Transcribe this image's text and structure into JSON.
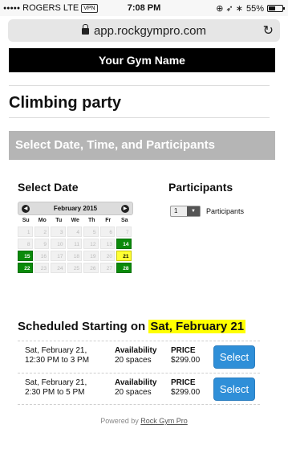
{
  "status": {
    "signal_dots": "●●●●●",
    "carrier": "ROGERS",
    "network": "LTE",
    "vpn": "VPN",
    "time": "7:08 PM",
    "icons": "⊕ ➶ ∗",
    "battery": "55%",
    "battery_level": 0.55
  },
  "browser": {
    "url": "app.rockgympro.com",
    "reload_icon": "reload-icon"
  },
  "header": {
    "gym_name": "Your Gym Name"
  },
  "page": {
    "title": "Climbing party"
  },
  "section": {
    "title": "Select Date, Time, and Participants"
  },
  "date_picker": {
    "label": "Select Date",
    "month": "February 2015",
    "prev": "◀",
    "next": "▶",
    "weekdays": [
      "Su",
      "Mo",
      "Tu",
      "We",
      "Th",
      "Fr",
      "Sa"
    ],
    "days": [
      {
        "d": "1",
        "s": "off"
      },
      {
        "d": "2",
        "s": "off"
      },
      {
        "d": "3",
        "s": "off"
      },
      {
        "d": "4",
        "s": "off"
      },
      {
        "d": "5",
        "s": "off"
      },
      {
        "d": "6",
        "s": "off"
      },
      {
        "d": "7",
        "s": "off"
      },
      {
        "d": "8",
        "s": "off"
      },
      {
        "d": "9",
        "s": "off"
      },
      {
        "d": "10",
        "s": "off"
      },
      {
        "d": "11",
        "s": "off"
      },
      {
        "d": "12",
        "s": "off"
      },
      {
        "d": "13",
        "s": "off"
      },
      {
        "d": "14",
        "s": "avail"
      },
      {
        "d": "15",
        "s": "avail"
      },
      {
        "d": "16",
        "s": "off"
      },
      {
        "d": "17",
        "s": "off"
      },
      {
        "d": "18",
        "s": "off"
      },
      {
        "d": "19",
        "s": "off"
      },
      {
        "d": "20",
        "s": "off"
      },
      {
        "d": "21",
        "s": "selected"
      },
      {
        "d": "22",
        "s": "avail"
      },
      {
        "d": "23",
        "s": "off"
      },
      {
        "d": "24",
        "s": "off"
      },
      {
        "d": "25",
        "s": "off"
      },
      {
        "d": "26",
        "s": "off"
      },
      {
        "d": "27",
        "s": "off"
      },
      {
        "d": "28",
        "s": "avail"
      }
    ],
    "colors": {
      "available": "#0a8a0a",
      "selected": "#ffff33"
    }
  },
  "participants": {
    "label": "Participants",
    "selected": "1",
    "arrow": "▼",
    "suffix": "Participants"
  },
  "schedule": {
    "title_prefix": "Scheduled Starting on",
    "date_highlight": "Sat, February 21",
    "highlight_color": "#ffff00",
    "sessions": [
      {
        "date_line1": "Sat, February 21,",
        "date_line2": "12:30 PM to 3 PM",
        "avail_label": "Availability",
        "avail_value": "20 spaces",
        "price_label": "PRICE",
        "price_value": "$299.00",
        "button": "Select"
      },
      {
        "date_line1": "Sat, February 21,",
        "date_line2": "2:30 PM to 5 PM",
        "avail_label": "Availability",
        "avail_value": "20 spaces",
        "price_label": "PRICE",
        "price_value": "$299.00",
        "button": "Select"
      }
    ]
  },
  "footer": {
    "prefix": "Powered by",
    "link": "Rock Gym Pro"
  }
}
